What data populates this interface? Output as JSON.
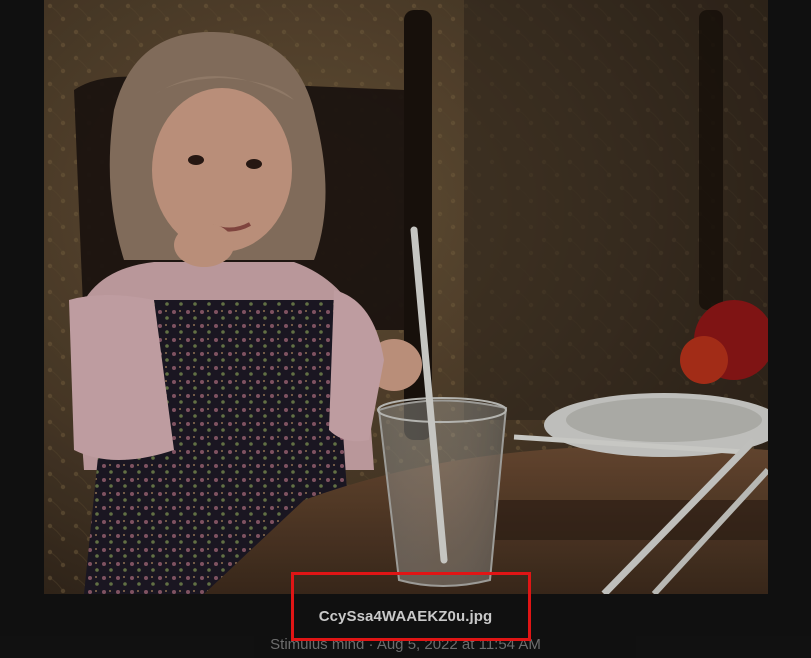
{
  "image": {
    "file_name": "CcySsa4WAAEKZ0u.jpg",
    "meta": "Stimulus mind · Aug 5, 2022 at 11:54 AM",
    "alt": "Photo"
  },
  "annotation": {
    "color": "#e01515"
  }
}
